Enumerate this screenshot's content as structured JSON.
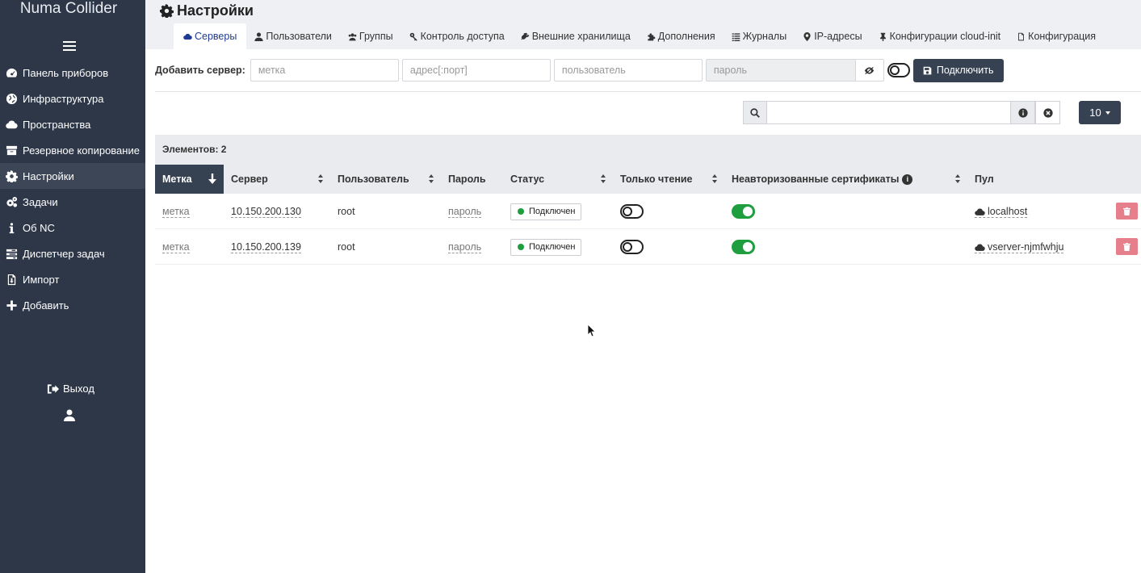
{
  "app": {
    "title": "Numa Collider"
  },
  "sidebar": {
    "items": [
      {
        "label": "Панель приборов",
        "icon": "dashboard-icon"
      },
      {
        "label": "Инфраструктура",
        "icon": "globe-icon"
      },
      {
        "label": "Пространства",
        "icon": "cloud-icon"
      },
      {
        "label": "Резервное копирование",
        "icon": "archive-icon"
      },
      {
        "label": "Настройки",
        "icon": "gear-icon",
        "active": true
      },
      {
        "label": "Задачи",
        "icon": "gears-icon"
      },
      {
        "label": "Об NC",
        "icon": "info-icon"
      },
      {
        "label": "Диспетчер задач",
        "icon": "tasks-icon"
      },
      {
        "label": "Импорт",
        "icon": "import-icon"
      },
      {
        "label": "Добавить",
        "icon": "plus-icon"
      }
    ],
    "logout_label": "Выход"
  },
  "header": {
    "title": "Настройки",
    "tabs": [
      {
        "label": "Серверы",
        "icon": "cloud-icon",
        "active": true
      },
      {
        "label": "Пользователи",
        "icon": "user-icon"
      },
      {
        "label": "Группы",
        "icon": "users-icon"
      },
      {
        "label": "Контроль доступа",
        "icon": "key-icon"
      },
      {
        "label": "Внешние хранилища",
        "icon": "plug-icon"
      },
      {
        "label": "Дополнения",
        "icon": "puzzle-icon"
      },
      {
        "label": "Журналы",
        "icon": "list-icon"
      },
      {
        "label": "IP-адресы",
        "icon": "map-marker-icon"
      },
      {
        "label": "Конфигурации cloud-init",
        "icon": "thumbtack-icon"
      },
      {
        "label": "Конфигурация",
        "icon": "file-icon"
      }
    ]
  },
  "add_server": {
    "label": "Добавить сервер:",
    "label_placeholder": "метка",
    "address_placeholder": "адрес[:порт]",
    "user_placeholder": "пользователь",
    "password_placeholder": "пароль",
    "connect_label": "Подключить"
  },
  "search": {
    "value": "",
    "per_page": "10"
  },
  "table": {
    "count_label": "Элементов: 2",
    "columns": [
      "Метка",
      "Сервер",
      "Пользователь",
      "Пароль",
      "Статус",
      "Только чтение",
      "Неавторизованные сертификаты",
      "Пул"
    ],
    "rows": [
      {
        "label": "метка",
        "server": "10.150.200.130",
        "user": "root",
        "password": "пароль",
        "status": "Подключен",
        "read_only": false,
        "unauthorized_certs": true,
        "pool": "localhost"
      },
      {
        "label": "метка",
        "server": "10.150.200.139",
        "user": "root",
        "password": "пароль",
        "status": "Подключен",
        "read_only": false,
        "unauthorized_certs": true,
        "pool": "vserver-njmfwhju"
      }
    ]
  },
  "colors": {
    "sidebar": "#2d3748",
    "accent": "#364152",
    "success": "#1e9e3e",
    "danger": "#e57f8b",
    "active_tab_text": "#1f3a93"
  }
}
